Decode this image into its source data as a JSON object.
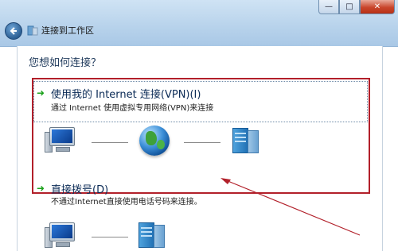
{
  "window": {
    "title": "连接到工作区",
    "controls": {
      "minimize": "—",
      "maximize": "□",
      "close": "✕"
    }
  },
  "icons": {
    "back": "back-arrow-icon",
    "nav": "workplace-icon",
    "option_arrow": "green-arrow-icon",
    "computer": "computer-icon",
    "internet": "globe-icon",
    "workplace": "server-icon"
  },
  "main": {
    "question": "您想如何连接？",
    "options": [
      {
        "title": "使用我的 Internet 连接(VPN)(I)",
        "description": "通过 Internet 使用虚拟专用网络(VPN)来连接"
      },
      {
        "title": "直接拨号(D)",
        "description": "不通过Internet直接使用电话号码来连接。"
      }
    ]
  },
  "colors": {
    "highlight_border": "#b2202a",
    "annotation_arrow": "#b2202a",
    "title_text": "#0a2a55",
    "question_text": "#1e395b"
  }
}
